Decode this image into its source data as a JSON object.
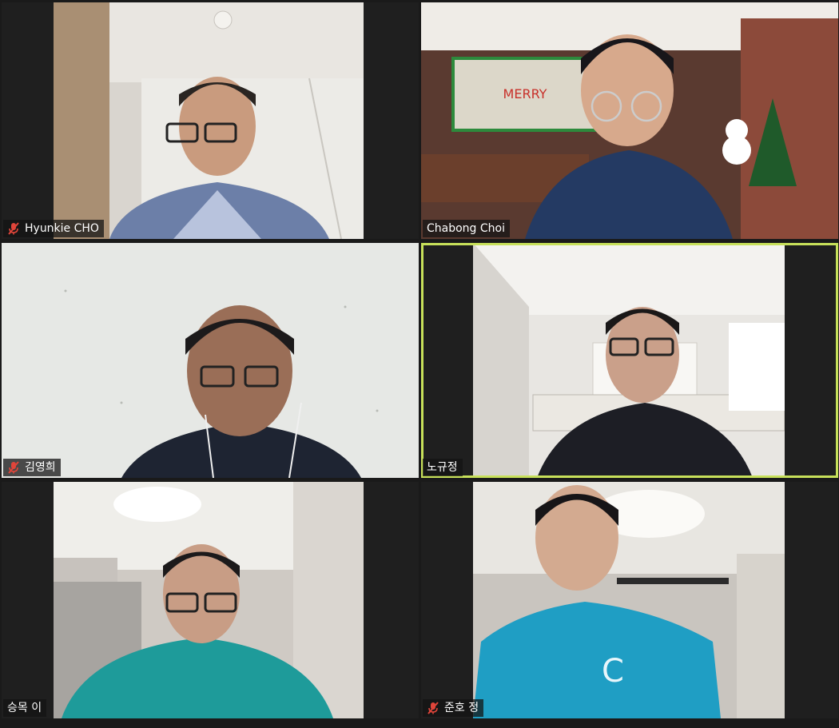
{
  "participants": [
    {
      "name": "Hyunkie CHO",
      "muted": true
    },
    {
      "name": "Chabong Choi",
      "muted": false
    },
    {
      "name": "김영희",
      "muted": true
    },
    {
      "name": "노규정",
      "muted": false,
      "active_speaker": true
    },
    {
      "name": "승목 이",
      "muted": false
    },
    {
      "name": "준호 정",
      "muted": true
    }
  ],
  "colors": {
    "active_speaker_border": "#c7e05a",
    "muted_icon": "#e0453a",
    "background": "#1a1a1a"
  }
}
